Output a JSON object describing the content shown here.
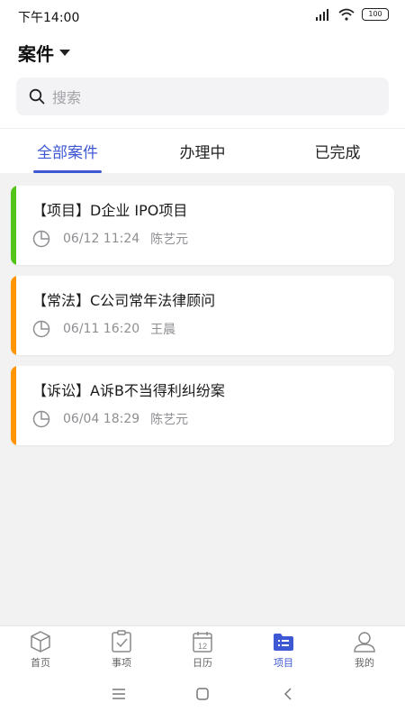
{
  "status_bar": {
    "time": "下午14:00",
    "battery": "100"
  },
  "header": {
    "title": "案件"
  },
  "search": {
    "placeholder": "搜索"
  },
  "tabs": [
    {
      "label": "全部案件",
      "active": true
    },
    {
      "label": "办理中",
      "active": false
    },
    {
      "label": "已完成",
      "active": false
    }
  ],
  "cases": [
    {
      "title": "【项目】D企业 IPO项目",
      "time": "06/12 11:24",
      "owner": "陈艺元",
      "accent": "#52c41a"
    },
    {
      "title": "【常法】C公司常年法律顾问",
      "time": "06/11 16:20",
      "owner": "王晨",
      "accent": "#ff9500"
    },
    {
      "title": "【诉讼】A诉B不当得利纠纷案",
      "time": "06/04 18:29",
      "owner": "陈艺元",
      "accent": "#ff9500"
    }
  ],
  "bottom_nav": [
    {
      "label": "首页",
      "icon": "home-cube-icon"
    },
    {
      "label": "事项",
      "icon": "clipboard-check-icon"
    },
    {
      "label": "日历",
      "icon": "calendar-icon",
      "day": "12"
    },
    {
      "label": "项目",
      "icon": "folder-list-icon",
      "active": true
    },
    {
      "label": "我的",
      "icon": "person-icon"
    }
  ],
  "colors": {
    "accent": "#3e58d4",
    "background": "#f2f2f2"
  }
}
